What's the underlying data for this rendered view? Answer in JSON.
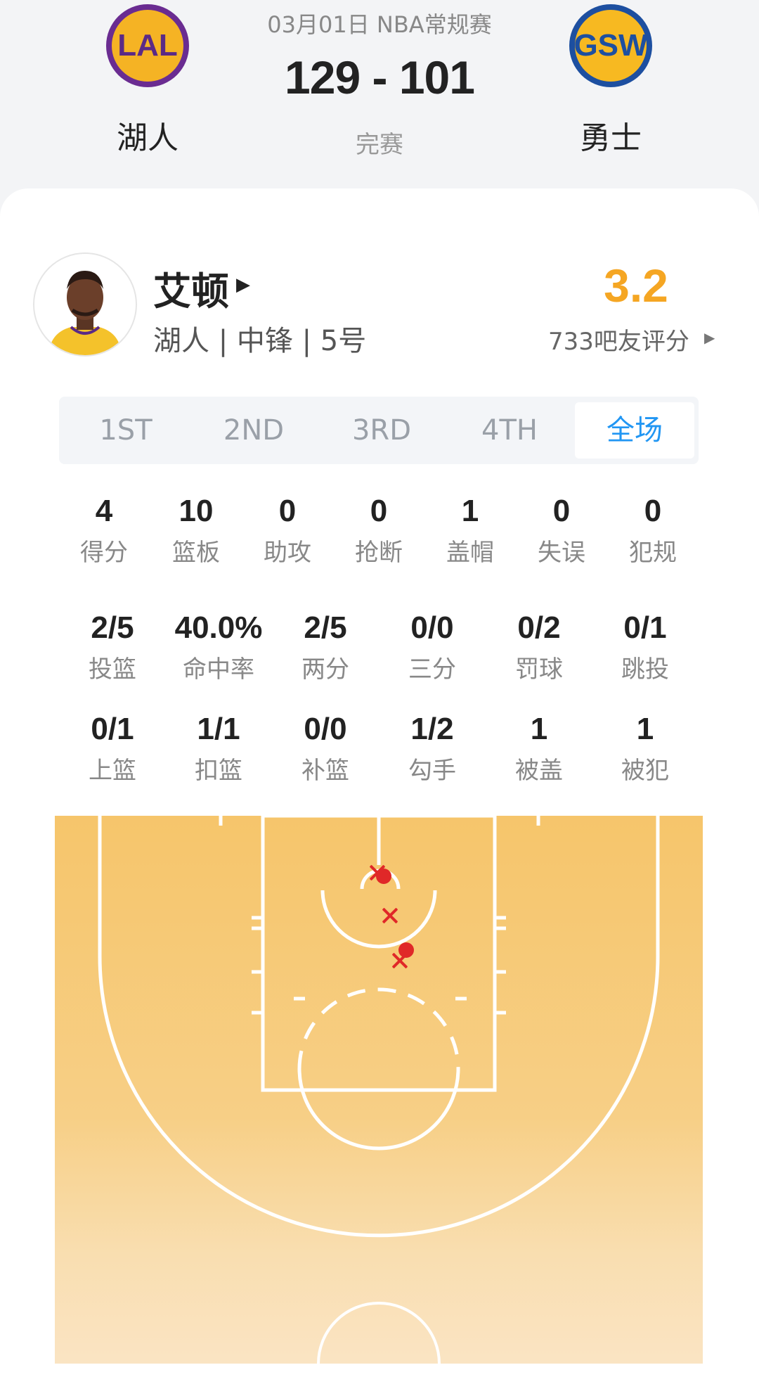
{
  "header": {
    "date": "03月01日 NBA常规赛",
    "score": "129 - 101",
    "status": "完赛",
    "home": {
      "abbr": "LAL",
      "name": "湖人",
      "logo_icon": "lakers-logo-icon"
    },
    "away": {
      "abbr": "GSW",
      "name": "勇士",
      "logo_icon": "warriors-logo-icon"
    }
  },
  "player": {
    "name": "艾顿",
    "info": "湖人 | 中锋 | 5号",
    "rating": "3.2",
    "rating_count": "733吧友评分"
  },
  "tabs": [
    "1ST",
    "2ND",
    "3RD",
    "4TH",
    "全场"
  ],
  "active_tab": "全场",
  "stats_row1": [
    {
      "value": "4",
      "label": "得分"
    },
    {
      "value": "10",
      "label": "篮板"
    },
    {
      "value": "0",
      "label": "助攻"
    },
    {
      "value": "0",
      "label": "抢断"
    },
    {
      "value": "1",
      "label": "盖帽"
    },
    {
      "value": "0",
      "label": "失误"
    },
    {
      "value": "0",
      "label": "犯规"
    }
  ],
  "stats_row2": [
    {
      "value": "2/5",
      "label": "投篮"
    },
    {
      "value": "40.0%",
      "label": "命中率"
    },
    {
      "value": "2/5",
      "label": "两分"
    },
    {
      "value": "0/0",
      "label": "三分"
    },
    {
      "value": "0/2",
      "label": "罚球"
    },
    {
      "value": "0/1",
      "label": "跳投"
    }
  ],
  "stats_row3": [
    {
      "value": "0/1",
      "label": "上篮"
    },
    {
      "value": "1/1",
      "label": "扣篮"
    },
    {
      "value": "0/0",
      "label": "补篮"
    },
    {
      "value": "1/2",
      "label": "勾手"
    },
    {
      "value": "1",
      "label": "被盖"
    },
    {
      "value": "1",
      "label": "被犯"
    }
  ],
  "colors": {
    "accent": "#2196f3",
    "rating": "#f5a623",
    "miss": "#e02828",
    "make": "#e02828",
    "court": "#f6c56b"
  }
}
